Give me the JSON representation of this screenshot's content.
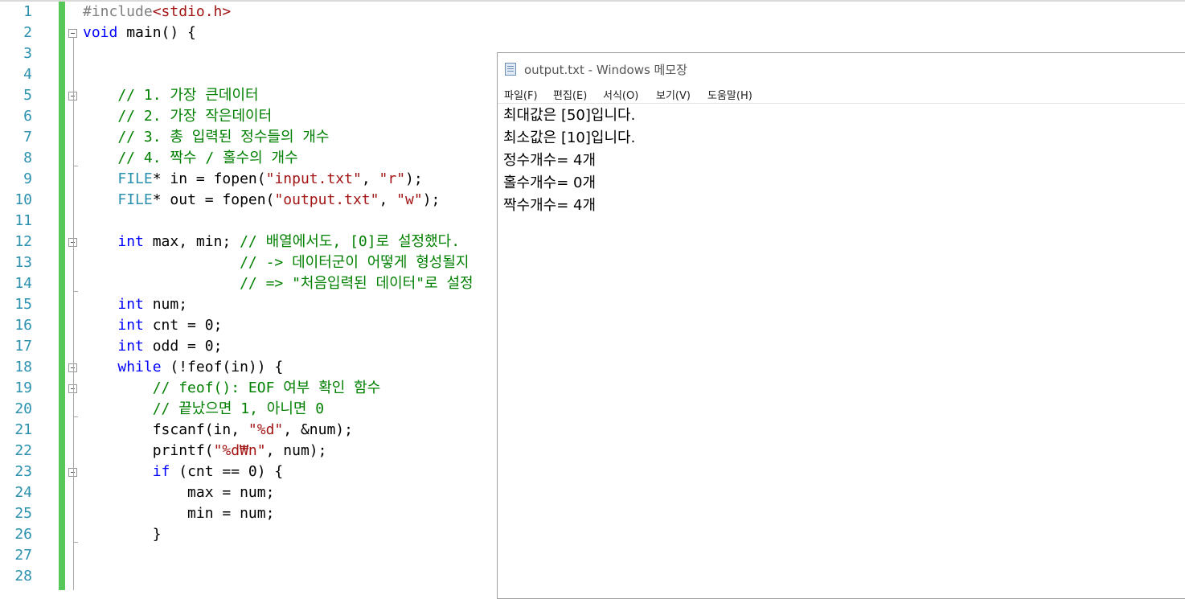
{
  "editor": {
    "line_numbers": [
      "1",
      "2",
      "3",
      "4",
      "5",
      "6",
      "7",
      "8",
      "9",
      "10",
      "11",
      "12",
      "13",
      "14",
      "15",
      "16",
      "17",
      "18",
      "19",
      "20",
      "21",
      "22",
      "23",
      "24",
      "25",
      "26",
      "27",
      "28"
    ],
    "lines": [
      [
        {
          "t": "#include",
          "c": "pp"
        },
        {
          "t": "<stdio.h>",
          "c": "st"
        }
      ],
      [
        {
          "t": "void",
          "c": "kw"
        },
        {
          "t": " main() {",
          "c": ""
        }
      ],
      [],
      [],
      [
        {
          "t": "    // 1. 가장 큰데이터",
          "c": "cm"
        }
      ],
      [
        {
          "t": "    // 2. 가장 작은데이터",
          "c": "cm"
        }
      ],
      [
        {
          "t": "    // 3. 총 입력된 정수들의 개수",
          "c": "cm"
        }
      ],
      [
        {
          "t": "    // 4. 짝수 / 홀수의 개수",
          "c": "cm"
        }
      ],
      [
        {
          "t": "    ",
          "c": ""
        },
        {
          "t": "FILE",
          "c": "ty"
        },
        {
          "t": "* in = fopen(",
          "c": ""
        },
        {
          "t": "\"input.txt\"",
          "c": "st"
        },
        {
          "t": ", ",
          "c": ""
        },
        {
          "t": "\"r\"",
          "c": "st"
        },
        {
          "t": ");",
          "c": ""
        }
      ],
      [
        {
          "t": "    ",
          "c": ""
        },
        {
          "t": "FILE",
          "c": "ty"
        },
        {
          "t": "* out = fopen(",
          "c": ""
        },
        {
          "t": "\"output.txt\"",
          "c": "st"
        },
        {
          "t": ", ",
          "c": ""
        },
        {
          "t": "\"w\"",
          "c": "st"
        },
        {
          "t": ");",
          "c": ""
        }
      ],
      [],
      [
        {
          "t": "    ",
          "c": ""
        },
        {
          "t": "int",
          "c": "kw"
        },
        {
          "t": " max, min; ",
          "c": ""
        },
        {
          "t": "// 배열에서도, [0]로 설정했다.",
          "c": "cm"
        }
      ],
      [
        {
          "t": "                  // -> 데이터군이 어떻게 형성될지",
          "c": "cm"
        }
      ],
      [
        {
          "t": "                  // => \"처음입력된 데이터\"로 설정",
          "c": "cm"
        }
      ],
      [
        {
          "t": "    ",
          "c": ""
        },
        {
          "t": "int",
          "c": "kw"
        },
        {
          "t": " num;",
          "c": ""
        }
      ],
      [
        {
          "t": "    ",
          "c": ""
        },
        {
          "t": "int",
          "c": "kw"
        },
        {
          "t": " cnt = 0;",
          "c": ""
        }
      ],
      [
        {
          "t": "    ",
          "c": ""
        },
        {
          "t": "int",
          "c": "kw"
        },
        {
          "t": " odd = 0;",
          "c": ""
        }
      ],
      [
        {
          "t": "    ",
          "c": ""
        },
        {
          "t": "while",
          "c": "kw"
        },
        {
          "t": " (!feof(in)) {",
          "c": ""
        }
      ],
      [
        {
          "t": "        // feof(): EOF 여부 확인 함수",
          "c": "cm"
        }
      ],
      [
        {
          "t": "        // 끝났으면 1, 아니면 0",
          "c": "cm"
        }
      ],
      [
        {
          "t": "        fscanf(in, ",
          "c": ""
        },
        {
          "t": "\"%d\"",
          "c": "st"
        },
        {
          "t": ", &num);",
          "c": ""
        }
      ],
      [
        {
          "t": "        printf(",
          "c": ""
        },
        {
          "t": "\"%d₩n\"",
          "c": "st"
        },
        {
          "t": ", num);",
          "c": ""
        }
      ],
      [
        {
          "t": "        ",
          "c": ""
        },
        {
          "t": "if",
          "c": "kw"
        },
        {
          "t": " (cnt == 0) {",
          "c": ""
        }
      ],
      [
        {
          "t": "            max = num;",
          "c": ""
        }
      ],
      [
        {
          "t": "            min = num;",
          "c": ""
        }
      ],
      [
        {
          "t": "        }",
          "c": ""
        }
      ],
      [],
      []
    ]
  },
  "notepad": {
    "title": "output.txt - Windows 메모장",
    "menu": [
      "파일(F)",
      "편집(E)",
      "서식(O)",
      "보기(V)",
      "도움말(H)"
    ],
    "lines": [
      "최대값은 [50]입니다.",
      "최소값은 [10]입니다.",
      "정수개수= 4개",
      "홀수개수= 0개",
      "짝수개수= 4개"
    ]
  }
}
